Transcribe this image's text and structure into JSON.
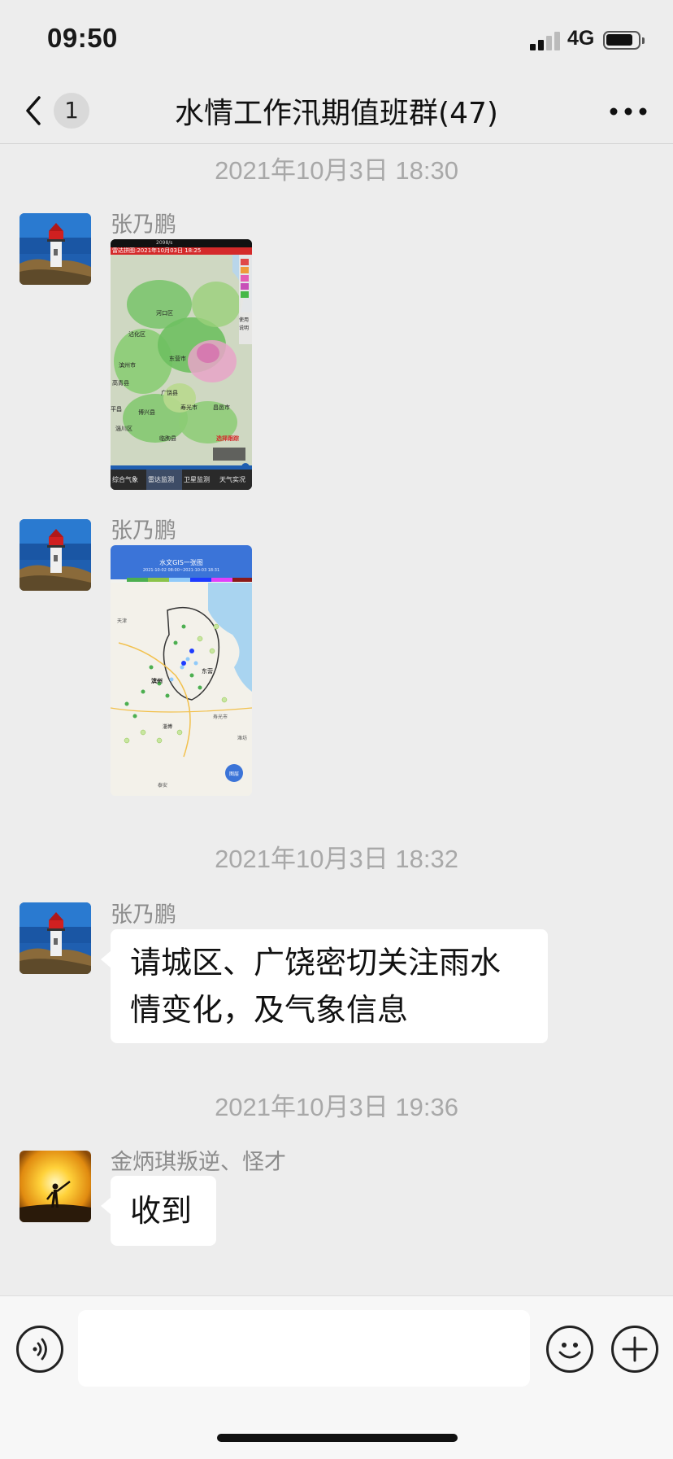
{
  "status_bar": {
    "time": "09:50",
    "network": "4G"
  },
  "nav": {
    "unread_count": "1",
    "title": "水情工作汛期值班群(47)"
  },
  "messages": {
    "t1": "2021年10月3日 18:30",
    "m1": {
      "sender": "张乃鹏"
    },
    "m2": {
      "sender": "张乃鹏"
    },
    "t2": "2021年10月3日 18:32",
    "m3": {
      "sender": "张乃鹏",
      "text_line1": "请城区、广饶密切关注雨水",
      "text_line2": "情变化，及气象信息"
    },
    "t3": "2021年10月3日 19:36",
    "m4": {
      "sender": "金炳琪叛逆、怪才",
      "text": "收到"
    }
  },
  "radar_screenshot": {
    "status": "2098/s",
    "header": "雷达拼图:2021年10月03日 18:25",
    "places": [
      "河口区",
      "沾化区",
      "东营市",
      "滨州市",
      "高青县",
      "广饶县",
      "博兴县",
      "寿光市",
      "昌邑市",
      "淄川区",
      "临朐县",
      "平昌"
    ],
    "legend": [
      "使用",
      "说明"
    ],
    "tag": "选择跟踪",
    "tabs": [
      "综合气象",
      "雷达监测",
      "卫星监测",
      "天气实况"
    ]
  },
  "gis_screenshot": {
    "title": "水文GIS一张图",
    "range": "2021-10-02 08:00~2021-10-03 18:31",
    "places": [
      "天津",
      "滨州",
      "东营",
      "寿光市",
      "潍坊",
      "淄博",
      "泰安"
    ],
    "button": "图层"
  },
  "colors": {
    "background": "#ededed",
    "bubble": "#ffffff",
    "time_separator": "#a8a8a8",
    "sender_name": "#8c8c8c"
  },
  "icons": [
    "back-icon",
    "more-icon",
    "voice-icon",
    "emoji-icon",
    "plus-icon"
  ]
}
